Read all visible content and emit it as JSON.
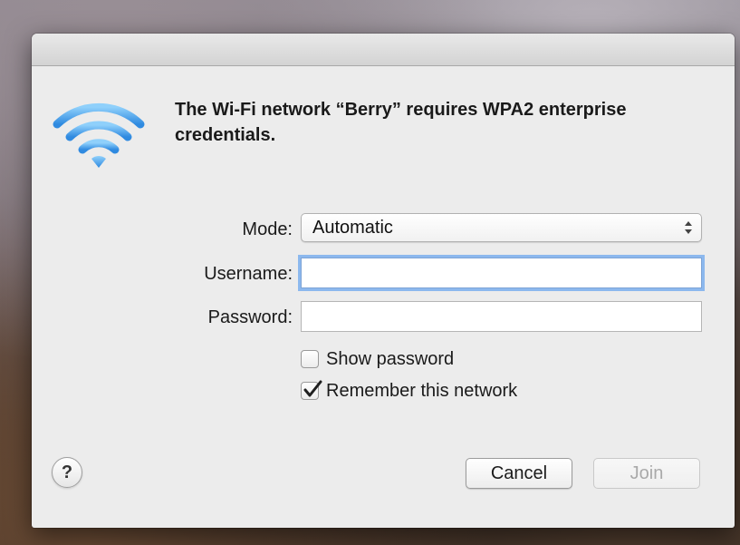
{
  "dialog": {
    "message": "The Wi-Fi network “Berry” requires WPA2 enterprise credentials.",
    "icon": "wifi-icon",
    "accent_color": "#3d9be9"
  },
  "form": {
    "mode": {
      "label": "Mode:",
      "value": "Automatic"
    },
    "username": {
      "label": "Username:",
      "value": ""
    },
    "password": {
      "label": "Password:",
      "value": ""
    },
    "show_password": {
      "label": "Show password",
      "checked": false
    },
    "remember_network": {
      "label": "Remember this network",
      "checked": true
    }
  },
  "buttons": {
    "help_label": "?",
    "cancel_label": "Cancel",
    "join_label": "Join"
  }
}
